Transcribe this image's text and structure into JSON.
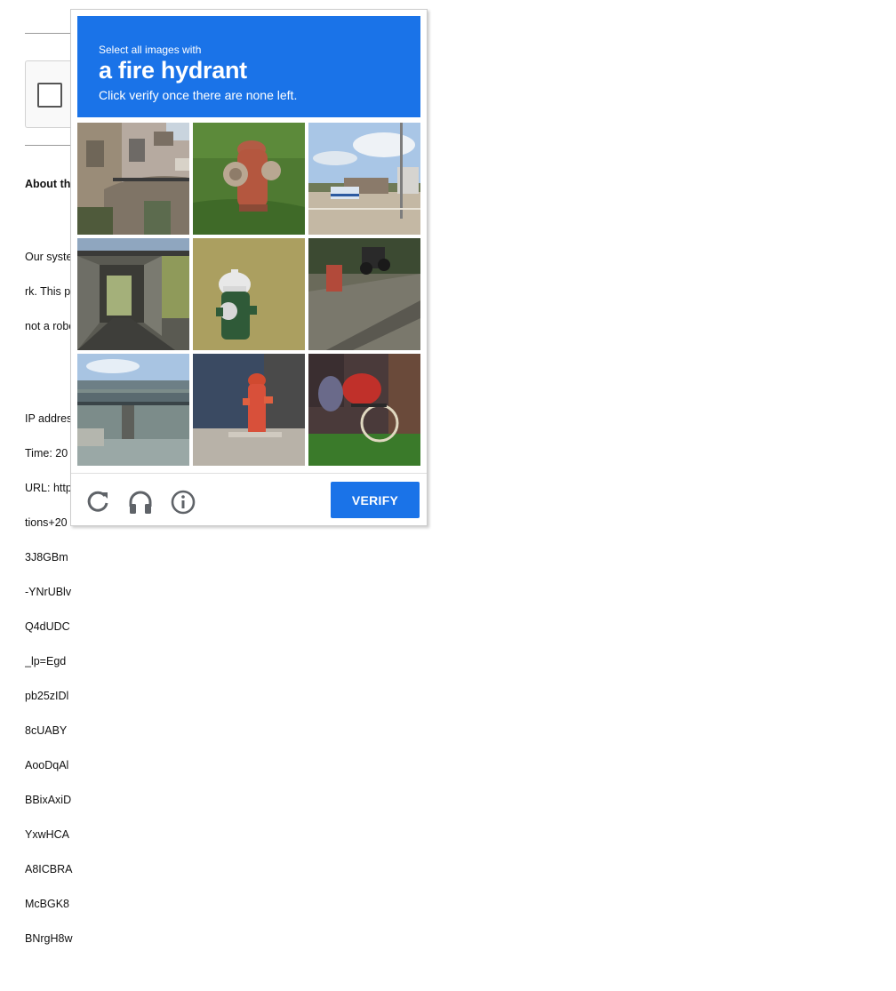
{
  "background_page": {
    "section_title": "About th",
    "lines_para1": [
      "Our syste",
      "rk. This p",
      "not a robo"
    ],
    "lines_para2": [
      "IP addres",
      "Time: 20",
      "URL: http",
      "tions+20",
      "3J8GBm",
      "-YNrUBlv",
      "Q4dUDC",
      "_lp=Egd",
      "pb25zIDl",
      "8cUABY",
      "AooDqAl",
      "BBixAxiD",
      "YxwHCA",
      "A8ICBRA",
      "McBGK8",
      "BNrgH8w"
    ]
  },
  "challenge": {
    "instruction_small": "Select all images with",
    "target_object": "a fire hydrant",
    "instruction_sub": "Click verify once there are none left.",
    "tiles": [
      {
        "content": "building with balcony and stone wall"
      },
      {
        "content": "red fire hydrant in grass"
      },
      {
        "content": "bus by roadside station"
      },
      {
        "content": "road underpass tunnel"
      },
      {
        "content": "green fire hydrant in grass"
      },
      {
        "content": "sidewalk with motorbike"
      },
      {
        "content": "bridge over water"
      },
      {
        "content": "red fire hydrant on sidewalk"
      },
      {
        "content": "bicycle near bushes"
      }
    ],
    "verify_label": "VERIFY",
    "icons": {
      "reload": "reload-icon",
      "audio": "headphones-icon",
      "info": "info-icon"
    },
    "accent_color": "#1a73e8"
  }
}
